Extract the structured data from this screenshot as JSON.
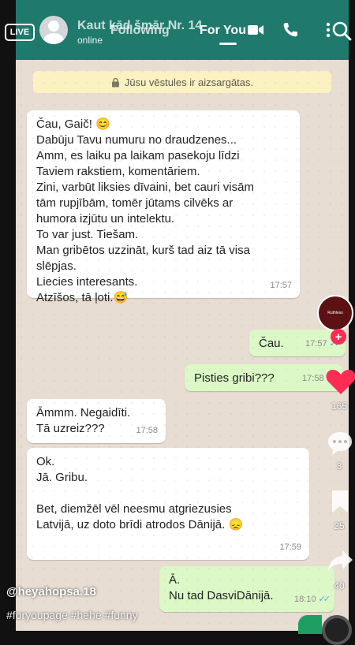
{
  "whatsapp": {
    "contact_name": "Kaut kād šmār Nr. 14",
    "contact_status": "online",
    "security_banner": "Jūsu vēstules ir aizsargātas."
  },
  "messages": [
    {
      "direction": "incoming",
      "lines": [
        "Čau, Gaič! 😊",
        "Dabūju Tavu numuru no draudzenes...",
        "Amm, es laiku pa laikam pasekoju līdzi",
        "Taviem rakstiem, komentāriem.",
        "Zini, varbūt liksies dīvaini, bet cauri visām",
        "tām rupjībām, tomēr jūtams cilvēks ar",
        "humora izjūtu un intelektu.",
        "To var just. Tiešam.",
        "Man gribētos uzzināt, kurš tad aiz tā visa",
        "slēpjas.",
        "Liecies interesants.",
        "Atzīšos, tā ļoti.😅"
      ],
      "time": "17:57"
    },
    {
      "direction": "outgoing",
      "lines": [
        "Čau."
      ],
      "time": "17:57"
    },
    {
      "direction": "outgoing",
      "lines": [
        "Pisties gribi???"
      ],
      "time": "17:58"
    },
    {
      "direction": "incoming",
      "lines": [
        "Āmmm. Negaidīti.",
        "Tā uzreiz???"
      ],
      "time": "17:58"
    },
    {
      "direction": "incoming",
      "lines": [
        "Ok.",
        "Jā. Gribu.",
        "",
        "Bet, diemžēl vēl neesmu atgriezusies",
        "Latvijā, uz doto brīdi atrodos Dānijā. 😞"
      ],
      "time": "17:59"
    },
    {
      "direction": "outgoing",
      "lines": [
        "Ā.",
        "Nu tad DasviDānijā."
      ],
      "time": "18:10"
    }
  ],
  "tiktok": {
    "live_label": "LIVE",
    "tab_following": "Following",
    "tab_for_you": "For You",
    "like_count": "165",
    "comment_count": "3",
    "bookmark_count": "25",
    "share_count": "40",
    "username": "@heyahopsa.18",
    "hashtags": "#foryoupage #hehe #funny",
    "profile_label": "Ruthless",
    "accent_color": "#fe2c55"
  },
  "colors": {
    "wa_header": "#1f7a6d",
    "incoming_bubble": "#ffffff",
    "outgoing_bubble": "#dcf8c6",
    "read_ticks": "#4fa8e0"
  }
}
